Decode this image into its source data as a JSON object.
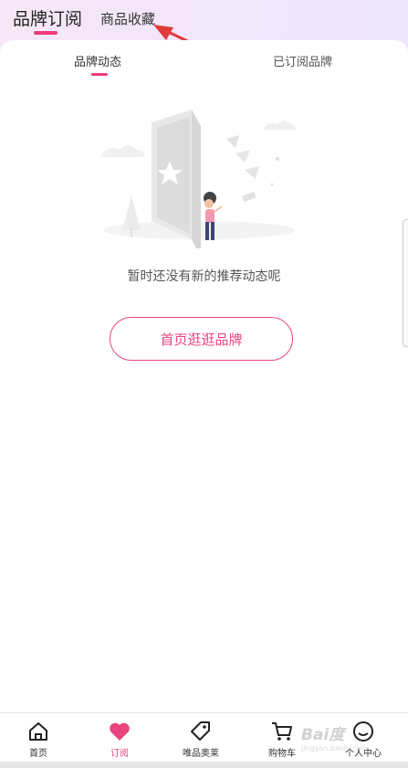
{
  "header": {
    "tabs": [
      "品牌订阅",
      "商品收藏"
    ],
    "active_index": 0
  },
  "sub_tabs": [
    "品牌动态",
    "已订阅品牌"
  ],
  "empty_state": {
    "message": "暂时还没有新的推荐动态呢",
    "button_label": "首页逛逛品牌"
  },
  "bottom_nav": {
    "items": [
      {
        "label": "首页",
        "icon": "home-icon"
      },
      {
        "label": "订阅",
        "icon": "heart-icon"
      },
      {
        "label": "唯品奥莱",
        "icon": "tag-icon"
      },
      {
        "label": "购物车",
        "icon": "cart-icon"
      },
      {
        "label": "个人中心",
        "icon": "user-icon"
      }
    ],
    "active_index": 1
  },
  "watermark": {
    "main": "Bai度",
    "sub": "jingyan.baidu.com"
  },
  "colors": {
    "accent": "#e8457f",
    "header_gradient": "#f3e6fb"
  }
}
